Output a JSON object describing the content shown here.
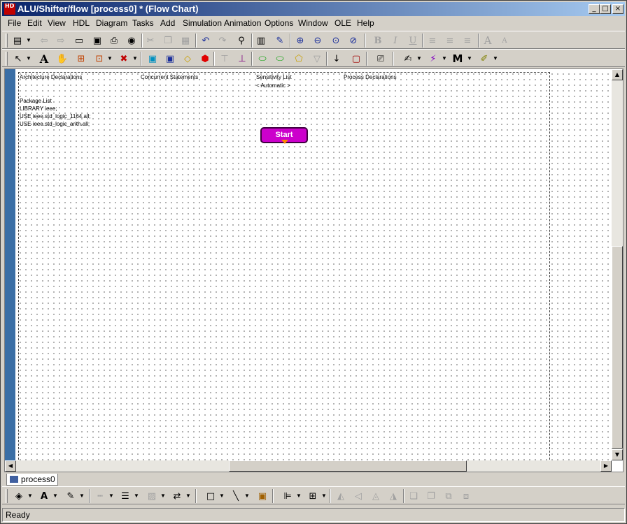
{
  "window": {
    "title": "ALU/Shifter/flow [process0] * (Flow Chart)",
    "app_icon_text": "HD",
    "controls": [
      "_",
      "□",
      "×"
    ]
  },
  "menubar": {
    "items": [
      "File",
      "Edit",
      "View",
      "HDL",
      "Diagram",
      "Tasks",
      "Add",
      "Simulation",
      "Animation",
      "Options",
      "Window",
      "OLE",
      "Help"
    ]
  },
  "toolbar_standard": {
    "icons": [
      "new-icon",
      "back-icon",
      "forward-icon",
      "open-folder-icon",
      "save-icon",
      "print-icon",
      "browse-web-icon",
      "cut-icon",
      "copy-icon",
      "paste-icon",
      "undo-icon",
      "redo-icon",
      "find-icon",
      "properties-icon",
      "edit-link-icon",
      "zoom-in-icon",
      "zoom-out-icon",
      "zoom-fit-icon",
      "zoom-selection-icon",
      "bold-icon",
      "italic-icon",
      "underline-icon",
      "align-left-icon",
      "align-center-icon",
      "align-right-icon",
      "font-larger-icon",
      "font-smaller-icon"
    ]
  },
  "toolbar_diagram": {
    "icons": [
      "select-arrow-icon",
      "text-tool-icon",
      "pan-hand-icon",
      "add-signal-icon",
      "add-component-icon",
      "delete-component-icon",
      "action-box-icon",
      "hierarchical-action-icon",
      "decision-icon",
      "stop-icon",
      "start-loop-icon",
      "end-loop-icon",
      "wait-icon",
      "wait-end-icon",
      "case-icon",
      "end-case-icon",
      "flow-arrow-icon",
      "embedded-block-icon",
      "view-hdl-icon",
      "generate-icon",
      "simulate-icon",
      "modelsim-icon",
      "checkin-icon"
    ]
  },
  "canvas": {
    "headers": {
      "architecture_declarations": "Architecture Declarations",
      "concurrent_statements": "Concurrent Statements",
      "sensitivity_list": "Sensitivity List",
      "sensitivity_value": "< Automatic >",
      "process_declarations": "Process Declarations"
    },
    "package_list": {
      "title": "Package List",
      "lines": [
        "LIBRARY ieee;",
        "USE ieee.std_logic_1164.all;",
        "USE ieee.std_logic_arith.all;"
      ]
    },
    "start_label": "Start",
    "colors": {
      "start_fill": "#cc00cc",
      "strip": "#3a6ea5"
    }
  },
  "tabs": [
    {
      "label": "process0"
    }
  ],
  "toolbar_format": {
    "icons": [
      "fill-color-icon",
      "text-color-icon",
      "line-color-icon",
      "line-style-icon",
      "line-width-icon",
      "pattern-icon",
      "arrowheads-icon",
      "rectangle-icon",
      "line-icon",
      "image-icon",
      "align-icon",
      "distribute-icon",
      "flip-horizontal-icon",
      "flip-left-icon",
      "rotate-left-icon",
      "rotate-right-icon",
      "bring-front-icon",
      "send-back-icon",
      "group-icon",
      "ungroup-icon"
    ]
  },
  "status": {
    "text": "Ready"
  }
}
